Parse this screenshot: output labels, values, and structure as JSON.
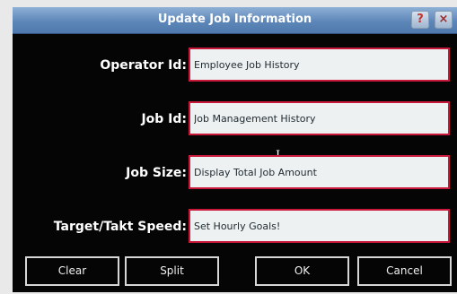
{
  "dialog": {
    "title": "Update Job Information",
    "help_label": "?",
    "close_label": "×"
  },
  "fields": {
    "operator_id": {
      "label": "Operator Id:",
      "value": "Employee Job History"
    },
    "job_id": {
      "label": "Job Id:",
      "value": "Job Management History"
    },
    "job_size": {
      "label": "Job Size:",
      "value": "Display Total Job Amount"
    },
    "target_speed": {
      "label": "Target/Takt Speed:",
      "value": "Set Hourly Goals!"
    }
  },
  "buttons": {
    "clear": "Clear",
    "split": "Split",
    "ok": "OK",
    "cancel": "Cancel"
  },
  "colors": {
    "field_border": "#c9183a",
    "dialog_background": "#050505",
    "titlebar": "#5d86b8"
  },
  "icons": {
    "text_cursor": "I"
  }
}
